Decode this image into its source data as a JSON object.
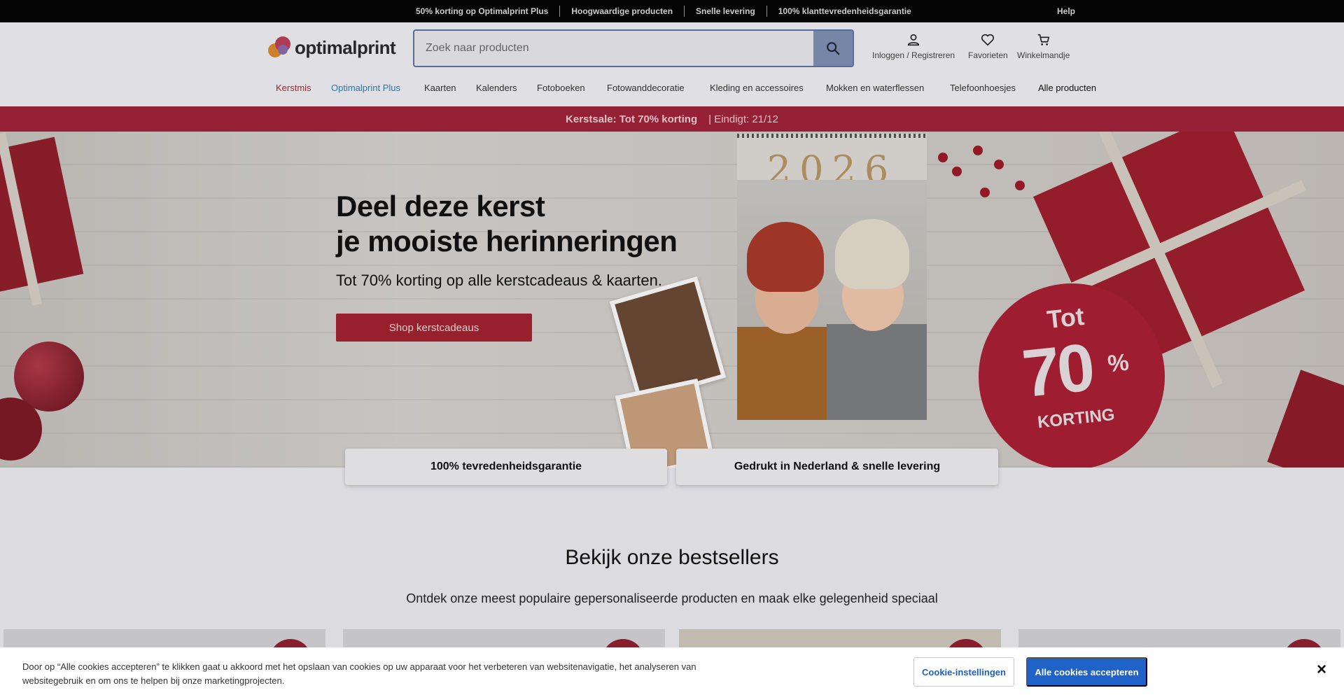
{
  "topbar": {
    "usps": [
      "50% korting op Optimalprint Plus",
      "Hoogwaardige producten",
      "Snelle levering",
      "100% klanttevredenheidsgarantie"
    ],
    "help": "Help"
  },
  "header": {
    "logo_text": "optimalprint",
    "search_placeholder": "Zoek naar producten",
    "login": "Inloggen / Registreren",
    "favorites": "Favorieten",
    "cart": "Winkelmandje"
  },
  "nav": {
    "items": [
      {
        "label": "Kerstmis",
        "color": "#b2232f"
      },
      {
        "label": "Optimalprint Plus",
        "color": "#2a7fb8"
      },
      {
        "label": "Kaarten"
      },
      {
        "label": "Kalenders"
      },
      {
        "label": "Fotoboeken"
      },
      {
        "label": "Fotowanddecoratie"
      },
      {
        "label": "Kleding en accessoires"
      },
      {
        "label": "Mokken en waterflessen"
      },
      {
        "label": "Telefoonhoesjes"
      },
      {
        "label": "Alle producten"
      }
    ]
  },
  "promo": {
    "main": "Kerstsale: Tot 70% korting",
    "end": "| Eindigt: 21/12"
  },
  "hero": {
    "title_line1": "Deel deze kerst",
    "title_line2": "je mooiste herinneringen",
    "subtitle": "Tot 70% korting op alle kerstcadeaus & kaarten.",
    "button": "Shop kerstcadeaus",
    "calendar_year": "2026",
    "badge": {
      "tot": "Tot",
      "number": "70",
      "percent": "%",
      "korting": "KORTING"
    }
  },
  "usp_cards": [
    "100% tevredenheidsgarantie",
    "Gedrukt in Nederland & snelle levering"
  ],
  "bestsellers": {
    "title": "Bekijk onze bestsellers",
    "subtitle": "Ontdek onze meest populaire gepersonaliseerde producten en maak elke gelegenheid speciaal"
  },
  "cookie": {
    "text": "Door op “Alle cookies accepteren” te klikken gaat u akkoord met het opslaan van cookies op uw apparaat voor het verbeteren van websitenavigatie, het analyseren van websitegebruik en om ons te helpen bij onze marketingprojecten.",
    "settings": "Cookie-instellingen",
    "accept": "Alle cookies accepteren",
    "close": "×"
  },
  "colors": {
    "brand_red": "#a1222f",
    "accept_blue": "#1f63c9"
  }
}
